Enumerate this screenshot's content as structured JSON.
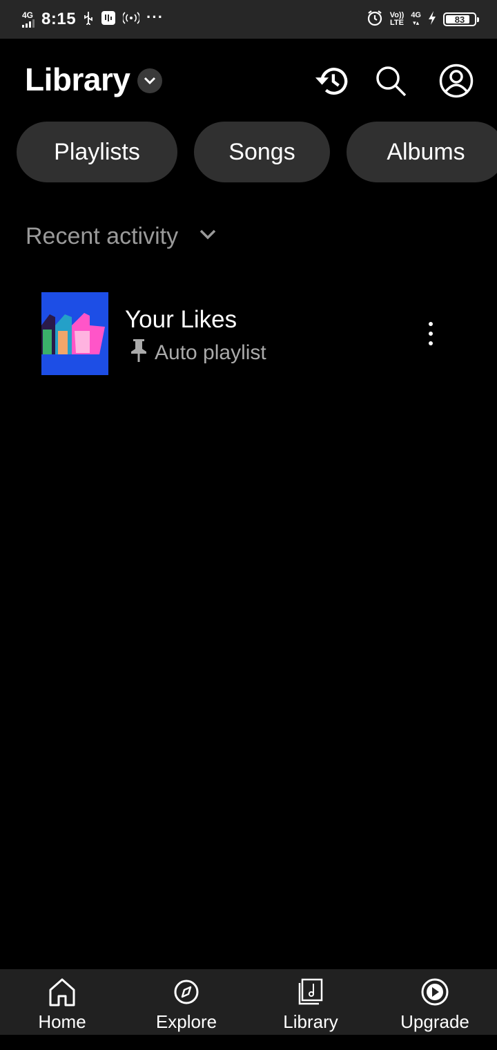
{
  "status_bar": {
    "network": "4G",
    "time": "8:15",
    "volte_top": "Vo))",
    "volte_bottom": "LTE",
    "network2": "4G",
    "battery": "83",
    "icons": [
      "usb-icon",
      "screenshot-icon",
      "hotspot-icon",
      "more-dots-icon",
      "alarm-icon",
      "charging-icon"
    ]
  },
  "header": {
    "title": "Library",
    "icons": [
      "chevron-down-icon",
      "history-icon",
      "search-icon",
      "account-icon"
    ]
  },
  "chips": [
    "Playlists",
    "Songs",
    "Albums"
  ],
  "sort": {
    "label": "Recent activity"
  },
  "items": [
    {
      "title": "Your Likes",
      "subtitle": "Auto playlist",
      "thumb_color": "#1d4ee6"
    }
  ],
  "bottom_nav": [
    {
      "label": "Home",
      "icon": "home-icon"
    },
    {
      "label": "Explore",
      "icon": "compass-icon"
    },
    {
      "label": "Library",
      "icon": "library-icon"
    },
    {
      "label": "Upgrade",
      "icon": "play-circle-icon"
    }
  ],
  "colors": {
    "background": "#000000",
    "status_bar": "#272727",
    "chip": "#303030",
    "bottom_nav": "#212121",
    "muted_text": "#9a9a9a"
  }
}
